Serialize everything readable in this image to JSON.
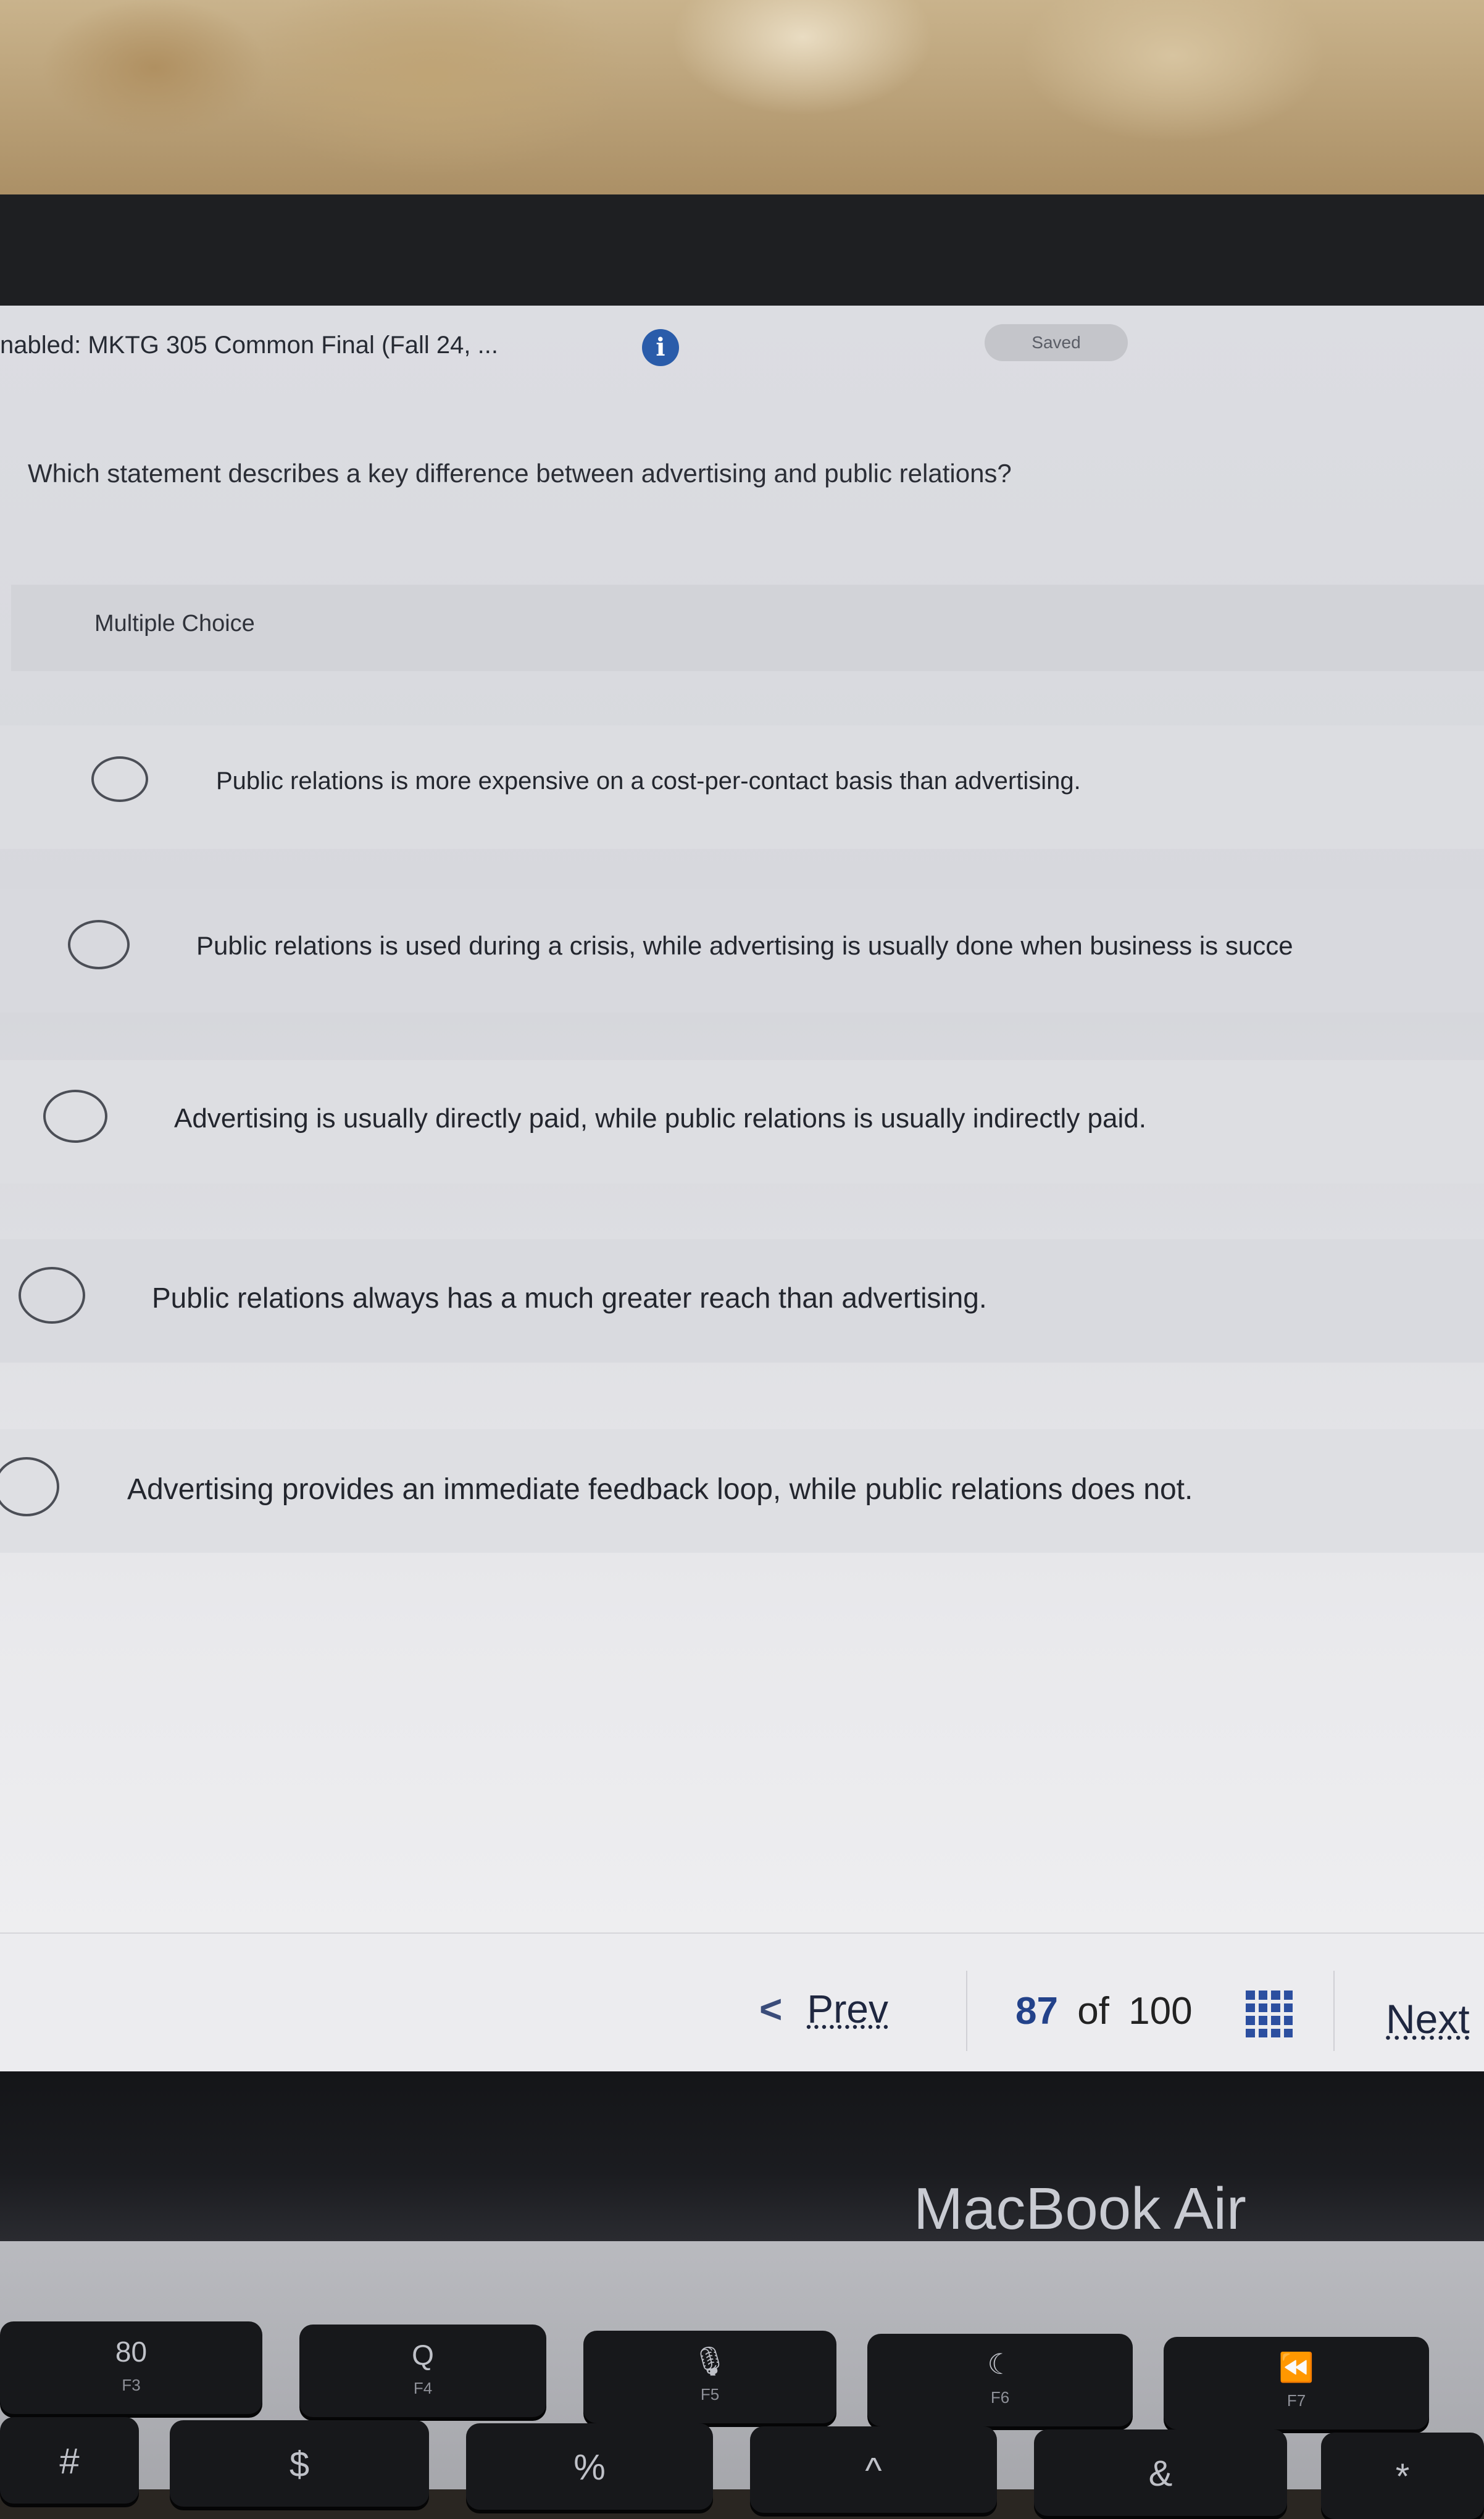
{
  "header": {
    "exam_title": "nabled: MKTG 305 Common Final (Fall 24, ...",
    "info_icon": "i",
    "saved_label": "Saved"
  },
  "question": {
    "text": "Which statement describes a key difference between advertising and public relations?",
    "type_label": "Multiple Choice"
  },
  "options": [
    {
      "text": "Public relations is more expensive on a cost-per-contact basis than advertising."
    },
    {
      "text": "Public relations is used during a crisis, while advertising is usually done when business is succe"
    },
    {
      "text": "Advertising is usually directly paid, while public relations is usually indirectly paid."
    },
    {
      "text": "Public relations always has a much greater reach than advertising."
    },
    {
      "text": "Advertising provides an immediate feedback loop, while public relations does not."
    }
  ],
  "navigation": {
    "prev_label": "Prev",
    "current_page": "87",
    "of_label": "of",
    "total_pages": "100",
    "next_label": "Next",
    "grid_icon": "question-grid-icon"
  },
  "device": {
    "brand": "MacBook Air"
  },
  "keys": {
    "f3_glyph": "80",
    "f3_label": "F3",
    "f4_glyph": "Q",
    "f4_label": "F4",
    "f5_glyph": "🎙",
    "f5_label": "F5",
    "f6_glyph": "☾",
    "f6_label": "F6",
    "f7_glyph": "⏪",
    "f7_label": "F7",
    "hash": "#",
    "dollar": "$",
    "percent": "%",
    "caret": "^",
    "ampersand": "&",
    "asterisk": "*"
  },
  "colors": {
    "accent_blue": "#2a5caa",
    "page_current": "#23428a",
    "camera_led": "#46d84e"
  }
}
